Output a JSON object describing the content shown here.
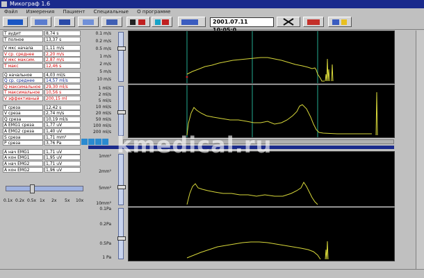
{
  "window": {
    "title": "Микограф 1.6"
  },
  "menu": [
    "Файл",
    "Измерения",
    "Пациент",
    "Специальные",
    "О программе"
  ],
  "toolbar": {
    "datetime": "2001.07.11 10:05:0"
  },
  "params": [
    {
      "label": "Т аудит",
      "value": "8,74 s",
      "color": "#000000"
    },
    {
      "label": "Т полное",
      "value": "13,37 s",
      "color": "#000000"
    },
    {
      "label": "V мкс начала",
      "value": "1,11 m/s",
      "color": "#000000"
    },
    {
      "label": "V ср. среднее",
      "value": "2,20 m/s",
      "color": "#d40000"
    },
    {
      "label": "V мкс максим.",
      "value": "2,87 m/s",
      "color": "#d40000"
    },
    {
      "label": "T макс",
      "value": "12,46 s",
      "color": "#d40000"
    },
    {
      "label": "Q начальное",
      "value": "4,03 ml/s",
      "color": "#000000"
    },
    {
      "label": "Q ср. среднее",
      "value": "14,57 ml/s",
      "color": "#001a8c"
    },
    {
      "label": "Q максимальное",
      "value": "29,30 ml/s",
      "color": "#d40000"
    },
    {
      "label": "T максимальное",
      "value": "10,56 s",
      "color": "#d40000"
    },
    {
      "label": "V эффективный",
      "value": "200,15 ml",
      "color": "#d40000"
    },
    {
      "label": "T среза",
      "value": "12,42 s",
      "color": "#000000"
    },
    {
      "label": "V среза",
      "value": "2,74 m/s",
      "color": "#000000"
    },
    {
      "label": "Q среза",
      "value": "10,19 ml/s",
      "color": "#000000"
    },
    {
      "label": "A EMG1 среза",
      "value": "1,77 uV",
      "color": "#000000"
    },
    {
      "label": "A EMG2 среза",
      "value": "1,40 uV",
      "color": "#000000"
    },
    {
      "label": "S среза",
      "value": "1,71 mm²",
      "color": "#000000"
    },
    {
      "label": "P среза",
      "value": "3,76 Pa",
      "color": "#000000"
    },
    {
      "label": "A нач EMG1",
      "value": "1,71 uV",
      "color": "#000000"
    },
    {
      "label": "A кон EMG1",
      "value": "1,95 uV",
      "color": "#000000"
    },
    {
      "label": "A нач EMG2",
      "value": "1,71 uV",
      "color": "#000000"
    },
    {
      "label": "A кон EMG2",
      "value": "1,96 uV",
      "color": "#000000"
    }
  ],
  "speed": {
    "labels": [
      "0.1x",
      "0.2x",
      "0.5x",
      "1x",
      "2x",
      "5x",
      "10x"
    ],
    "selected": "1x"
  },
  "axes": {
    "velocity": [
      "0.1 m/s",
      "0.2 m/s",
      "0.5 m/s",
      "1 m/s",
      "2 m/s",
      "5 m/s",
      "10 m/s"
    ],
    "flow": [
      "1 ml/s",
      "2 ml/s",
      "5 ml/s",
      "10 ml/s",
      "20 ml/s",
      "50 ml/s",
      "100 ml/s",
      "200 ml/s"
    ],
    "area": [
      "1mm²",
      "2mm²",
      "5mm²",
      "10mm²"
    ],
    "pressure": [
      "0.1Pa",
      "0.2Pa",
      "0.5Pa",
      "1 Pa"
    ]
  },
  "watermark": "kmedical.ru",
  "colors": {
    "trace": "#d8d83a",
    "marker": "#1f8f7a",
    "plot_bg": "#000000",
    "title_bar": "#1a2a8c"
  }
}
